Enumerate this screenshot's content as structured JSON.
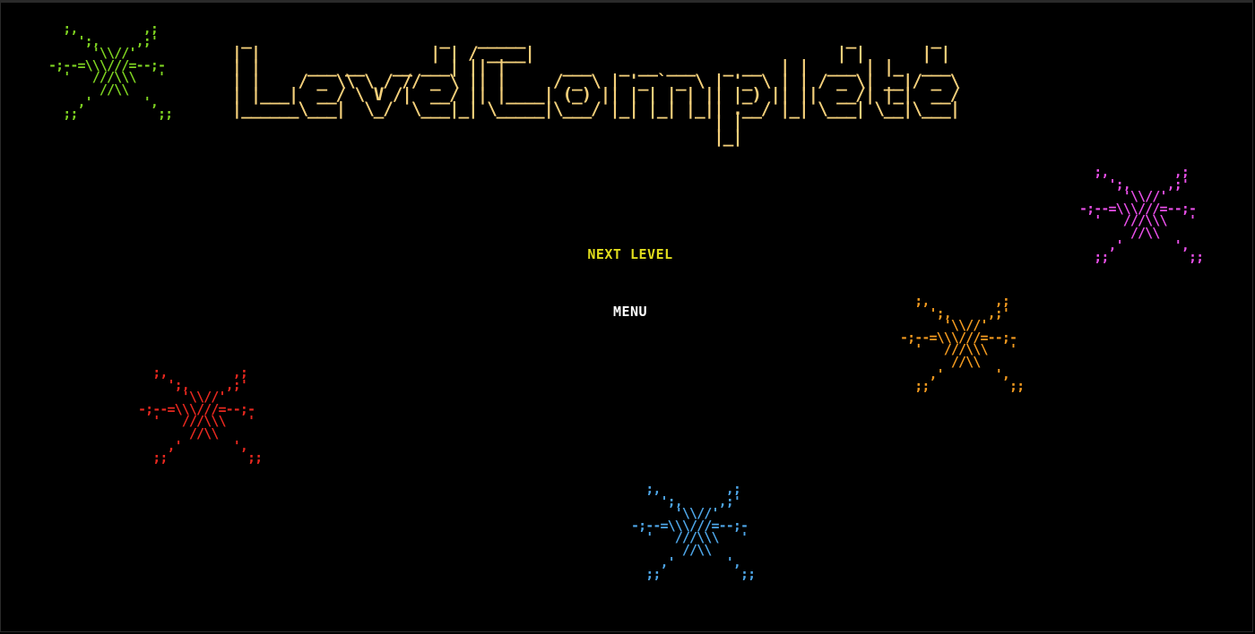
{
  "title": {
    "text": "Level Complete",
    "art": [
      "  _                    _   _____                                  _        _            ",
      " | |                  | | / ____|                                | |      | |           ",
      " | |     ___ __   __ ___| || |      ___   _ __ ___   _ __  | |  ___ | |_  ___ ",
      " | |    / _ \\\\ \\ / // _ \\ || |     / _ \\ | '_ ` _ \\ | '_ \\ | | / _ \\| __|/ _ \\",
      " | |___|  __/ \\ V /|  __/ || |____| (_) || | | | | || |_) || ||  __/| |_|  __/",
      " |______\\___|  \\_/  \\___|_| \\_____|\\___/ |_| |_| |_|| .__/ |_| \\___| \\__|\\___|",
      "                                                    | |                        ",
      "                                                    |_|                        "
    ],
    "color": "#f3cf7a"
  },
  "menu": {
    "next_level_label": "NEXT LEVEL",
    "menu_label": "MENU",
    "selected_color": "#e0dc1c",
    "default_color": "#ffffff"
  },
  "spider_art": [
    "  ;,         ,;",
    "    ';,     ,;'",
    "      '\\\\//'",
    "-;--=\\\\\\///=--;-",
    "  '   ///\\\\\\   '",
    "       //\\\\",
    "    ,'       ',",
    "  ;;           ;;"
  ],
  "spiders": [
    {
      "name": "spider-green",
      "color": "#7ed321"
    },
    {
      "name": "spider-pink",
      "color": "#e84fe8"
    },
    {
      "name": "spider-orange",
      "color": "#f39a1f"
    },
    {
      "name": "spider-red",
      "color": "#e8281f"
    },
    {
      "name": "spider-blue",
      "color": "#4ea6e8"
    }
  ]
}
